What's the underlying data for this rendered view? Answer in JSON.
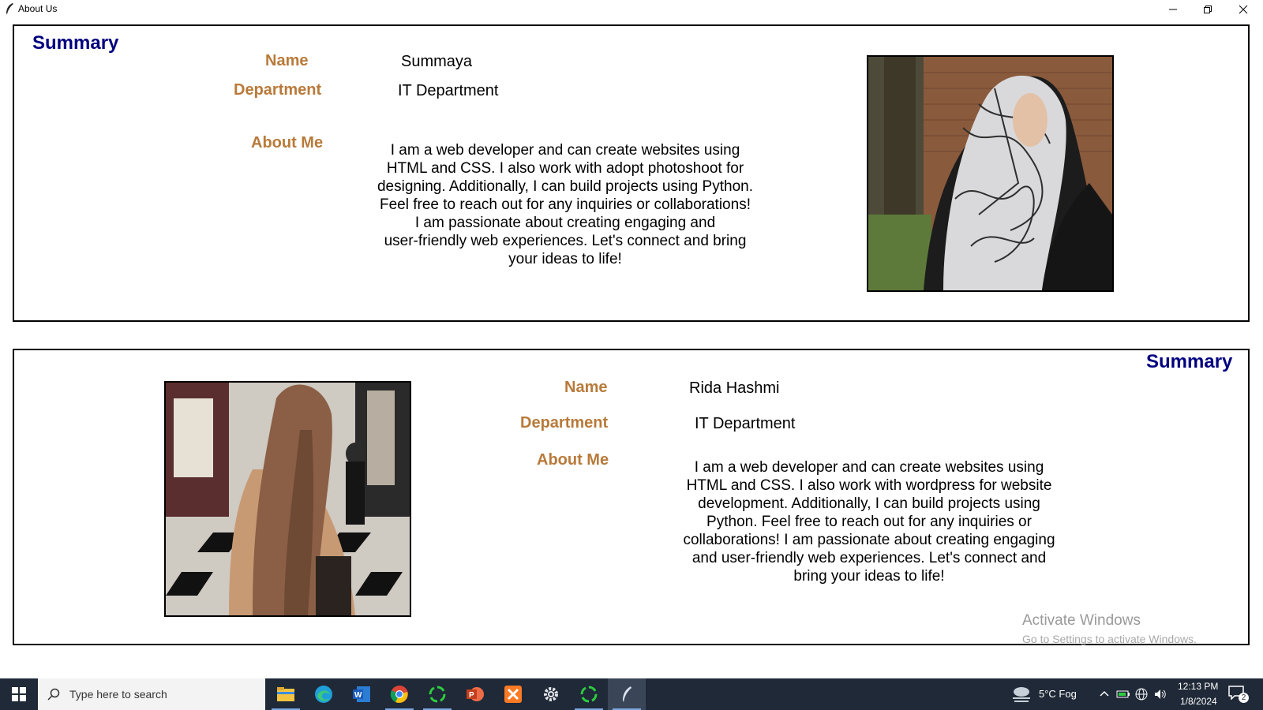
{
  "window": {
    "title": "About Us",
    "controls": [
      "minimize-icon",
      "restore-icon",
      "close-icon"
    ]
  },
  "profile1": {
    "summary": "Summary",
    "name_label": "Name",
    "name": "Summaya",
    "department_label": "Department",
    "department": "IT Department",
    "about_label": "About Me",
    "about": "I am a web developer and can create websites using\nHTML and CSS. I also work with adopt photoshoot for\ndesigning. Additionally, I can build projects using Python.\nFeel free to reach out for any inquiries or collaborations!\nI am passionate about creating engaging and\nuser-friendly web experiences. Let's connect and bring\nyour ideas to life!"
  },
  "profile2": {
    "summary": "Summary",
    "name_label": "Name",
    "name": "Rida Hashmi",
    "department_label": "Department",
    "department": "IT Department",
    "about_label": "About Me",
    "about": "I am a web developer and can create websites using\nHTML and CSS. I also work with wordpress for website\ndevelopment. Additionally, I can build projects using\nPython. Feel free to reach out for any inquiries or\ncollaborations! I am passionate about creating engaging\nand user-friendly web experiences. Let's connect and\nbring your ideas to life!"
  },
  "watermark": {
    "line1": "Activate Windows",
    "line2": "Go to Settings to activate Windows."
  },
  "taskbar": {
    "search_placeholder": "Type here to search",
    "apps": [
      "file-explorer-icon",
      "edge-icon",
      "word-icon",
      "chrome-icon",
      "spinner-app-icon",
      "powerpoint-icon",
      "xampp-icon",
      "settings-icon",
      "spinner-app-icon",
      "feather-app-icon"
    ],
    "weather": "5°C  Fog",
    "time": "12:13 PM",
    "date": "1/8/2024",
    "notifications": "2"
  },
  "colors": {
    "summary": "#00007f",
    "label": "#b87a3a",
    "taskbar": "#1f2937"
  }
}
